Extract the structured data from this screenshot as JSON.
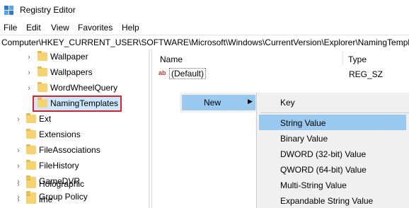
{
  "window": {
    "title": "Registry Editor"
  },
  "menu": [
    "File",
    "Edit",
    "View",
    "Favorites",
    "Help"
  ],
  "address": "Computer\\HKEY_CURRENT_USER\\SOFTWARE\\Microsoft\\Windows\\CurrentVersion\\Explorer\\NamingTemplates",
  "tree": {
    "items": [
      {
        "label": "Wallpaper",
        "expandable": true
      },
      {
        "label": "Wallpapers",
        "expandable": true
      },
      {
        "label": "WordWheelQuery",
        "expandable": true
      },
      {
        "label": "NamingTemplates",
        "expandable": false,
        "selected": true
      },
      {
        "label": "Ext",
        "expandable": true
      },
      {
        "label": "Extensions",
        "expandable": false
      },
      {
        "label": "FileAssociations",
        "expandable": true
      },
      {
        "label": "FileHistory",
        "expandable": true
      },
      {
        "label": "GameDVR",
        "expandable": true
      },
      {
        "label": "Group Policy",
        "expandable": true
      },
      {
        "label": "Holographic",
        "expandable": true
      },
      {
        "label": "ime",
        "expandable": true
      }
    ]
  },
  "list": {
    "columns": [
      "Name",
      "Type"
    ],
    "rows": [
      {
        "name": "(Default)",
        "type": "REG_SZ"
      }
    ]
  },
  "context_menu": {
    "label": "New",
    "arrow": "›"
  },
  "submenu": {
    "items": [
      "Key",
      "String Value",
      "Binary Value",
      "DWORD (32-bit) Value",
      "QWORD (64-bit) Value",
      "Multi-String Value",
      "Expandable String Value"
    ],
    "highlighted": "String Value"
  },
  "colors": {
    "selection": "#99c9ef",
    "highlight_border": "#e01f26",
    "folder": "#f6d36f"
  }
}
